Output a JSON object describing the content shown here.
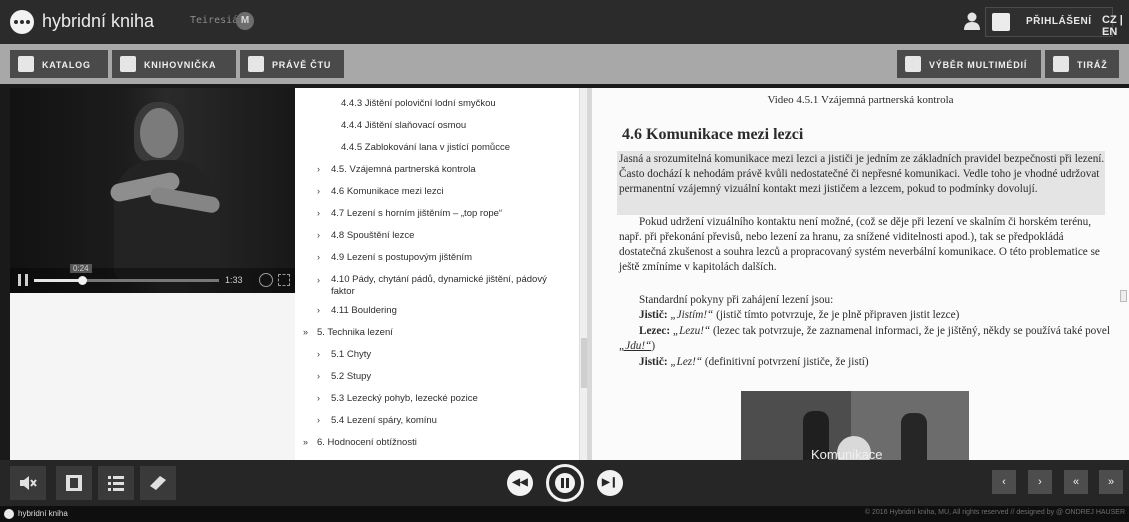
{
  "header": {
    "app_title": "hybridní kniha",
    "teiresias_label": "Teiresiás",
    "login_label": "PŘIHLÁŠENÍ",
    "lang_label": "CZ | EN"
  },
  "nav": {
    "catalog": "KATALOG",
    "library": "KNIHOVNIČKA",
    "reading": "PRÁVĚ ČTU",
    "multimedia": "VÝBĚR MULTIMÉDIÍ",
    "imprint": "TIRÁŽ"
  },
  "video": {
    "current_time": "0:24",
    "duration": "1:33",
    "progress_fraction": 0.26
  },
  "toc": {
    "items": [
      {
        "label": "4.4.3 Jištění poloviční lodní smyčkou",
        "level": 3,
        "chevron": ""
      },
      {
        "label": "4.4.4 Jištění slaňovací osmou",
        "level": 3,
        "chevron": ""
      },
      {
        "label": "4.4.5 Zablokování lana v jistící pomůcce",
        "level": 3,
        "chevron": ""
      },
      {
        "label": "4.5. Vzájemná partnerská kontrola",
        "level": 2,
        "chevron": "›"
      },
      {
        "label": "4.6 Komunikace mezi lezci",
        "level": 2,
        "chevron": "›"
      },
      {
        "label": "4.7 Lezení s horním jištěním – „top rope“",
        "level": 2,
        "chevron": "›"
      },
      {
        "label": "4.8 Spouštění lezce",
        "level": 2,
        "chevron": "›"
      },
      {
        "label": "4.9 Lezení s postupovým jištěním",
        "level": 2,
        "chevron": "›"
      },
      {
        "label": "4.10 Pády, chytání pádů, dynamické jištění, pádový",
        "label2": "faktor",
        "level": 2,
        "chevron": "›"
      },
      {
        "label": "4.11 Bouldering",
        "level": 2,
        "chevron": "›"
      },
      {
        "label": "5. Technika lezení",
        "level": 1,
        "chevron": "»"
      },
      {
        "label": "5.1 Chyty",
        "level": 2,
        "chevron": "›"
      },
      {
        "label": "5.2 Stupy",
        "level": 2,
        "chevron": "›"
      },
      {
        "label": "5.3 Lezecký pohyb, lezecké pozice",
        "level": 2,
        "chevron": "›"
      },
      {
        "label": "5.4 Lezení spáry, komínu",
        "level": 2,
        "chevron": "›"
      },
      {
        "label": "6. Hodnocení obtížnosti",
        "level": 1,
        "chevron": "»"
      }
    ]
  },
  "text": {
    "video_caption": "Video 4.5.1 Vzájemná partnerská kontrola",
    "heading": "4.6 Komunikace mezi lezci",
    "p1": "Jasná a srozumitelná komunikace mezi lezci a jističi je jedním ze základních pravidel bezpečnosti při lezení. Často dochází k nehodám právě kvůli nedostatečné či nepřesné komunikaci. Vedle toho je vhodné udržovat permanentní vzájemný vizuální kontakt mezi jističem a lezcem, pokud to podmínky dovolují.",
    "p2": "Pokud udržení vizuálního kontaktu není možné, (což se děje při lezení ve skalním či horském terénu, např. při překonání převisů, nebo lezení za hranu, za snížené viditelnosti apod.), tak se předpokládá dostatečná zkušenost a souhra lezců a propracovaný systém neverbální komunikace. O této problematice se ještě zmíníme v kapitolách dalších.",
    "p3": "Standardní pokyny při zahájení lezení jsou:",
    "l1_role": "Jistič:",
    "l1_quote": "„Jistím!“",
    "l1_rest": "(jistič tímto potvrzuje, že je plně připraven jistit lezce)",
    "l2_role": "Lezec:",
    "l2_quote": "„Lezu!“",
    "l2_rest": "(lezec tak potvrzuje, že zaznamenal informaci, že je jištěný, někdy se používá také povel",
    "l2_link": "„Jdu!“",
    "l2_tail": ")",
    "l3_role": "Jistič:",
    "l3_quote": "„Lez!“",
    "l3_rest": "(definitivní potvrzení jističe, že jistí)",
    "thumb_title": "Komunikace"
  },
  "footer": {
    "name": "hybridní kniha",
    "copyright": "© 2016 Hybridní kniha, MU, All rights reserved // designed by @ ONDREJ HAUSER"
  },
  "bottom": {
    "prev_label": "‹",
    "next_label": "›",
    "first_label": "«",
    "last_label": "»"
  }
}
